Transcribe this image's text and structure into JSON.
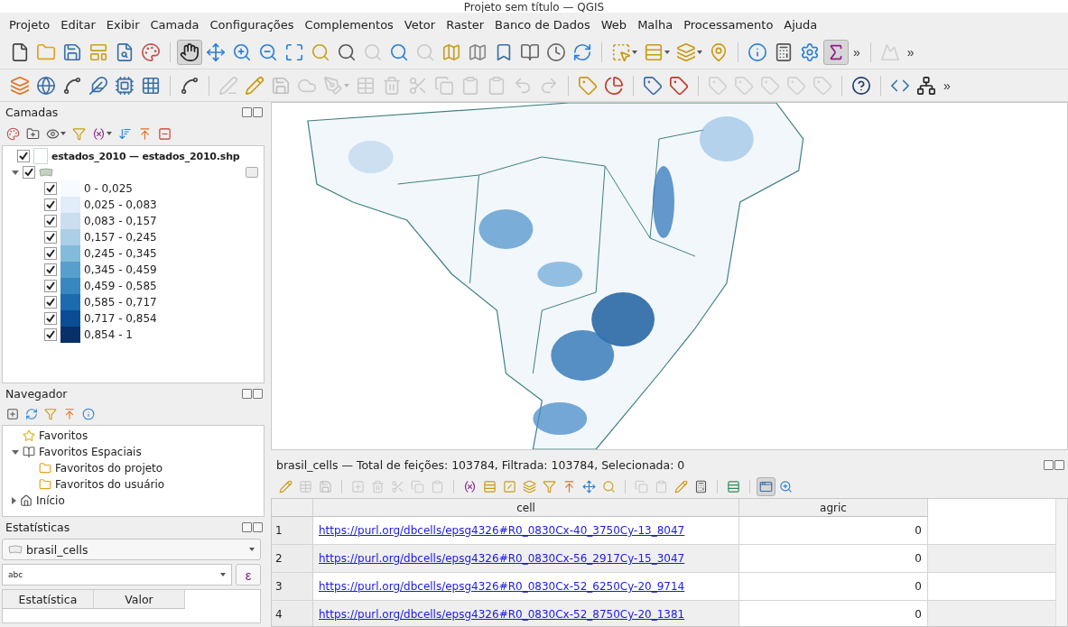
{
  "window": {
    "title": "Projeto sem título — QGIS"
  },
  "menu": [
    "Projeto",
    "Editar",
    "Exibir",
    "Camada",
    "Configurações",
    "Complementos",
    "Vetor",
    "Raster",
    "Banco de Dados",
    "Web",
    "Malha",
    "Processamento",
    "Ajuda"
  ],
  "toolbars": [
    [
      {
        "kind": "file"
      },
      {
        "kind": "folder"
      },
      {
        "kind": "save"
      },
      {
        "kind": "layout"
      },
      {
        "kind": "report"
      },
      {
        "kind": "style"
      },
      {
        "kind": "sep"
      },
      {
        "kind": "hand",
        "selected": true
      },
      {
        "kind": "move"
      },
      {
        "kind": "zoomin"
      },
      {
        "kind": "zoomout"
      },
      {
        "kind": "zoomfull"
      },
      {
        "kind": "zoomlayer"
      },
      {
        "kind": "zoomsel"
      },
      {
        "kind": "zoomnative",
        "disabled": true
      },
      {
        "kind": "zoomlast"
      },
      {
        "kind": "zoomnext",
        "disabled": true
      },
      {
        "kind": "mapview"
      },
      {
        "kind": "map3d"
      },
      {
        "kind": "bookmark"
      },
      {
        "kind": "bookmarks"
      },
      {
        "kind": "clock"
      },
      {
        "kind": "refresh"
      },
      {
        "kind": "sep"
      },
      {
        "kind": "select",
        "dropdown": true
      },
      {
        "kind": "selectattr",
        "dropdown": true
      },
      {
        "kind": "deselect",
        "dropdown": true
      },
      {
        "kind": "selloc"
      },
      {
        "kind": "sep"
      },
      {
        "kind": "identify"
      },
      {
        "kind": "abacus"
      },
      {
        "kind": "gear"
      },
      {
        "kind": "sigma",
        "selected": true
      },
      {
        "kind": "more",
        "label": "»"
      },
      {
        "kind": "sep"
      },
      {
        "kind": "profile",
        "disabled": true
      },
      {
        "kind": "more",
        "label": "»"
      }
    ],
    [
      {
        "kind": "addlayer"
      },
      {
        "kind": "addwms"
      },
      {
        "kind": "vertex"
      },
      {
        "kind": "feather"
      },
      {
        "kind": "chip"
      },
      {
        "kind": "grid"
      },
      {
        "kind": "sep"
      },
      {
        "kind": "vertex"
      },
      {
        "kind": "sep"
      },
      {
        "kind": "pencils",
        "disabled": true
      },
      {
        "kind": "pencil"
      },
      {
        "kind": "save",
        "disabled": true
      },
      {
        "kind": "blob",
        "disabled": true
      },
      {
        "kind": "digitize",
        "disabled": true,
        "dropdown": true
      },
      {
        "kind": "tableedit",
        "disabled": true
      },
      {
        "kind": "trash",
        "disabled": true
      },
      {
        "kind": "scissors",
        "disabled": true
      },
      {
        "kind": "copy",
        "disabled": true
      },
      {
        "kind": "paste",
        "disabled": true
      },
      {
        "kind": "paste",
        "disabled": true
      },
      {
        "kind": "undo",
        "disabled": true
      },
      {
        "kind": "redo",
        "disabled": true
      },
      {
        "kind": "sep"
      },
      {
        "kind": "label"
      },
      {
        "kind": "pie"
      },
      {
        "kind": "sep"
      },
      {
        "kind": "labelpin"
      },
      {
        "kind": "labelred"
      },
      {
        "kind": "sep"
      },
      {
        "kind": "label",
        "disabled": true
      },
      {
        "kind": "label",
        "disabled": true
      },
      {
        "kind": "label",
        "disabled": true
      },
      {
        "kind": "label",
        "disabled": true
      },
      {
        "kind": "label",
        "disabled": true
      },
      {
        "kind": "sep"
      },
      {
        "kind": "help"
      },
      {
        "kind": "sep"
      },
      {
        "kind": "python"
      },
      {
        "kind": "plugin"
      },
      {
        "kind": "more",
        "label": "»"
      }
    ]
  ],
  "layers_panel": {
    "title": "Camadas",
    "tools": [
      {
        "kind": "style"
      },
      {
        "kind": "addgroup"
      },
      {
        "kind": "eye",
        "dropdown": true
      },
      {
        "kind": "filter"
      },
      {
        "kind": "expr",
        "dropdown": true
      },
      {
        "kind": "sortdown"
      },
      {
        "kind": "arrowup"
      },
      {
        "kind": "removelayer"
      }
    ],
    "layers": [
      {
        "kind": "layer",
        "name": "estados_2010 — estados_2010.shp",
        "checked": true
      },
      {
        "kind": "group",
        "checked": true,
        "expanded": true,
        "children": [
          {
            "label": "0 - 0,025",
            "checked": true,
            "color": "#f7fbff"
          },
          {
            "label": "0,025 - 0,083",
            "checked": true,
            "color": "#e1edf8"
          },
          {
            "label": "0,083 - 0,157",
            "checked": true,
            "color": "#cadef0"
          },
          {
            "label": "0,157 - 0,245",
            "checked": true,
            "color": "#abcfe6"
          },
          {
            "label": "0,245 - 0,345",
            "checked": true,
            "color": "#82bbdb"
          },
          {
            "label": "0,345 - 0,459",
            "checked": true,
            "color": "#57a0ce"
          },
          {
            "label": "0,459 - 0,585",
            "checked": true,
            "color": "#3787c0"
          },
          {
            "label": "0,585 - 0,717",
            "checked": true,
            "color": "#1c6aaf"
          },
          {
            "label": "0,717 - 0,854",
            "checked": true,
            "color": "#0b4d94"
          },
          {
            "label": "0,854 - 1",
            "checked": true,
            "color": "#08306b"
          }
        ]
      }
    ]
  },
  "browser_panel": {
    "title": "Navegador",
    "tools": [
      {
        "kind": "addbox"
      },
      {
        "kind": "refresh"
      },
      {
        "kind": "filter"
      },
      {
        "kind": "arrowup"
      },
      {
        "kind": "identify"
      }
    ],
    "items": [
      {
        "kind": "star",
        "label": "Favoritos"
      },
      {
        "kind": "bookmarks",
        "label": "Favoritos Espaciais",
        "expanded": true,
        "children": [
          {
            "kind": "folder",
            "label": "Favoritos do projeto"
          },
          {
            "kind": "folder",
            "label": "Favoritos do usuário"
          }
        ]
      },
      {
        "kind": "home",
        "label": "Início",
        "expanded": false
      }
    ]
  },
  "statistics_panel": {
    "title": "Estatísticas",
    "layer": "brasil_cells",
    "field": "abc",
    "expression_button": "ε",
    "columns": [
      "Estatística",
      "Valor"
    ]
  },
  "attribute_table": {
    "title": "brasil_cells — Total de feições: 103784, Filtrada: 103784, Selecionada: 0",
    "tools": [
      {
        "kind": "pencil"
      },
      {
        "kind": "tableedit",
        "disabled": true
      },
      {
        "kind": "save",
        "disabled": true
      },
      {
        "kind": "sep"
      },
      {
        "kind": "addrow",
        "disabled": true
      },
      {
        "kind": "trash",
        "disabled": true
      },
      {
        "kind": "scissors",
        "disabled": true
      },
      {
        "kind": "copy",
        "disabled": true
      },
      {
        "kind": "paste",
        "disabled": true
      },
      {
        "kind": "sep"
      },
      {
        "kind": "expr"
      },
      {
        "kind": "selectattr"
      },
      {
        "kind": "invert"
      },
      {
        "kind": "deselect"
      },
      {
        "kind": "filter"
      },
      {
        "kind": "arrowup"
      },
      {
        "kind": "move"
      },
      {
        "kind": "zoomlayer"
      },
      {
        "kind": "sep"
      },
      {
        "kind": "copy",
        "disabled": true
      },
      {
        "kind": "paste",
        "disabled": true
      },
      {
        "kind": "pencil"
      },
      {
        "kind": "abacus"
      },
      {
        "kind": "sep"
      },
      {
        "kind": "rows"
      },
      {
        "kind": "sep"
      },
      {
        "kind": "form",
        "selected": true
      },
      {
        "kind": "zoomin"
      }
    ],
    "columns": [
      "cell",
      "agric"
    ],
    "rows": [
      {
        "index": "1",
        "cell": "https://purl.org/dbcells/epsg4326#R0_0830Cx-40_3750Cy-13_8047",
        "agric": "0"
      },
      {
        "index": "2",
        "cell": "https://purl.org/dbcells/epsg4326#R0_0830Cx-56_2917Cy-15_3047",
        "agric": "0"
      },
      {
        "index": "3",
        "cell": "https://purl.org/dbcells/epsg4326#R0_0830Cx-52_6250Cy-20_9714",
        "agric": "0"
      },
      {
        "index": "4",
        "cell": "https://purl.org/dbcells/epsg4326#R0_0830Cx-52_8750Cy-20_1381",
        "agric": "0"
      }
    ]
  }
}
